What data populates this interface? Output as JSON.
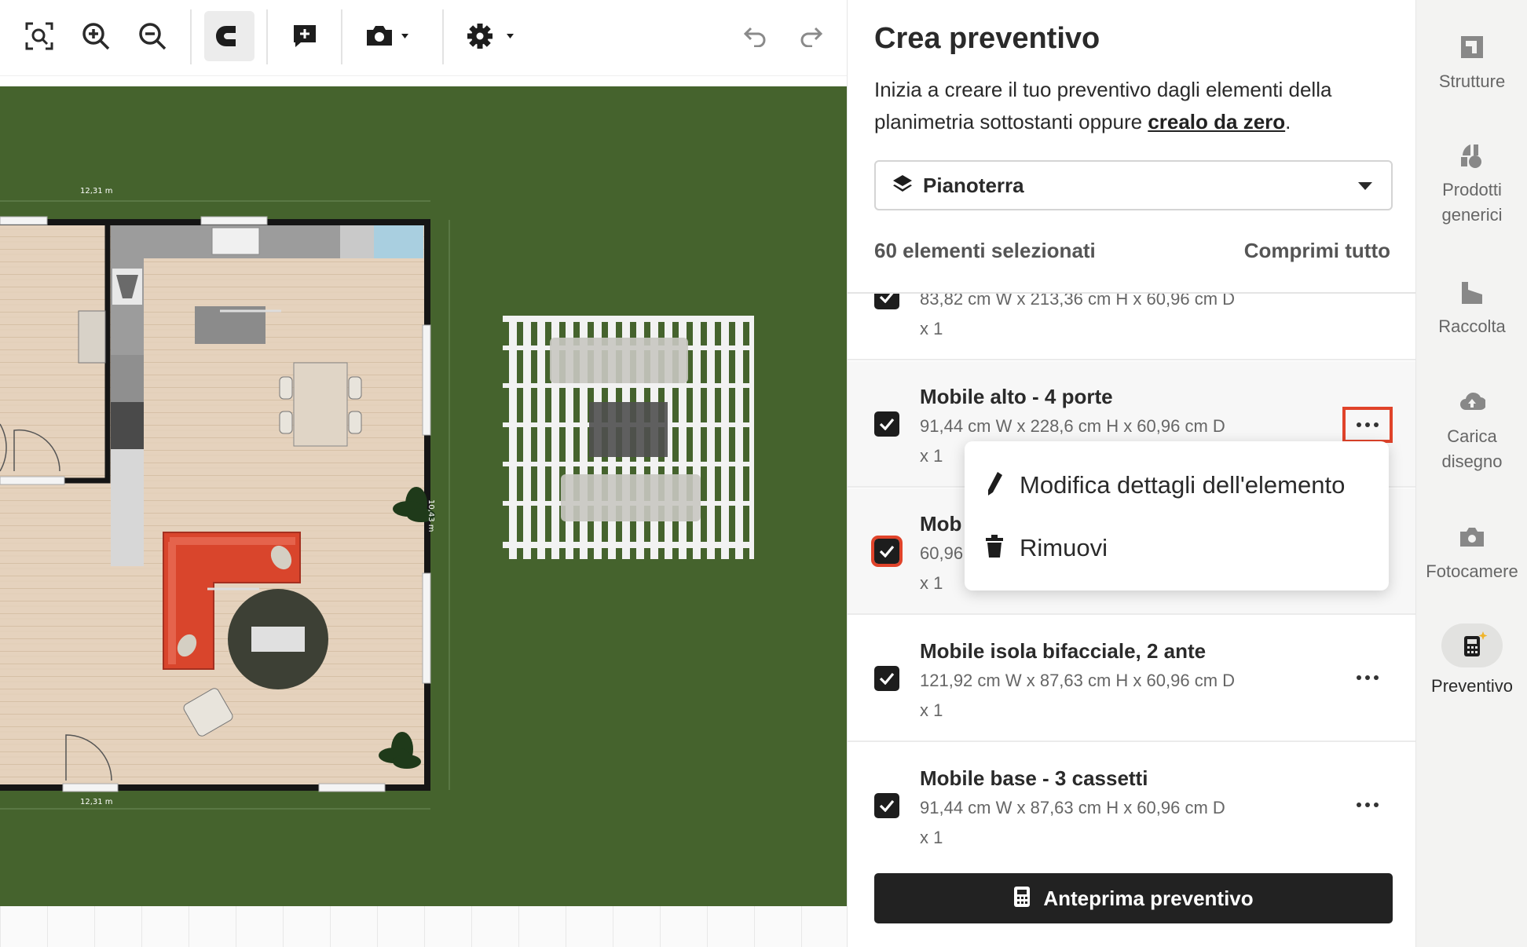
{
  "toolbar": {
    "icons": [
      "zoom-fit-icon",
      "zoom-in-icon",
      "zoom-out-icon",
      "magnet-icon",
      "add-note-icon",
      "camera-icon",
      "settings-icon",
      "undo-icon",
      "redo-icon"
    ]
  },
  "panel": {
    "title": "Crea preventivo",
    "intro_text": "Inizia a creare il tuo preventivo dagli elementi della planimetria sottostanti oppure ",
    "intro_link": "crealo da zero",
    "intro_end": ".",
    "floor_select": "Pianoterra",
    "selected_count": "60 elementi selezionati",
    "collapse_all": "Comprimi tutto",
    "items": [
      {
        "name": "",
        "dims": "83,82 cm W x 213,36 cm H x 60,96 cm D",
        "qty": "x 1"
      },
      {
        "name": "Mobile alto - 4 porte",
        "dims": "91,44 cm W x 228,6 cm H x 60,96 cm D",
        "qty": "x 1"
      },
      {
        "name": "Mob",
        "dims": "60,96",
        "qty": "x 1"
      },
      {
        "name": "Mobile isola bifacciale, 2 ante",
        "dims": "121,92 cm W x 87,63 cm H x 60,96 cm D",
        "qty": "x 1"
      },
      {
        "name": "Mobile base - 3 cassetti",
        "dims": "91,44 cm W x 87,63 cm H x 60,96 cm D",
        "qty": "x 1"
      }
    ],
    "context_menu": {
      "edit": "Modifica dettagli dell'elemento",
      "remove": "Rimuovi"
    },
    "preview_button": "Anteprima preventivo"
  },
  "rail": {
    "items": [
      {
        "label": "Strutture",
        "icon": "structures-icon"
      },
      {
        "label": "Prodotti generici",
        "icon": "generic-products-icon"
      },
      {
        "label": "Raccolta",
        "icon": "collection-icon"
      },
      {
        "label": "Carica disegno",
        "icon": "upload-drawing-icon"
      },
      {
        "label": "Fotocamere",
        "icon": "cameras-icon"
      },
      {
        "label": "Preventivo",
        "icon": "quote-calculator-icon"
      }
    ]
  },
  "floorplan": {
    "dimension_top": "12,31 m",
    "dimension_bottom": "12,31 m",
    "dimension_right": "10,43 m"
  },
  "colors": {
    "grass": "#45632d",
    "highlight": "#e0432a",
    "primary_button": "#222222",
    "sofa": "#d9452c"
  }
}
